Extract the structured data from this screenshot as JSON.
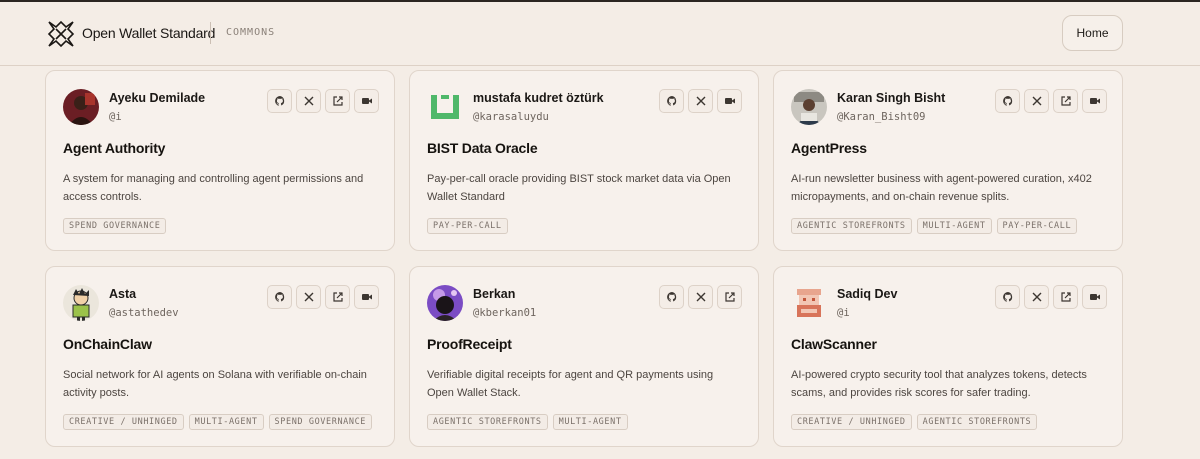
{
  "header": {
    "brand": "Open Wallet Standard",
    "section": "COMMONS",
    "home_label": "Home"
  },
  "cards": [
    {
      "name": "Ayeku Demilade",
      "handle": "@i",
      "title": "Agent Authority",
      "description": "A system for managing and controlling agent permissions and access controls.",
      "tags": [
        "SPEND GOVERNANCE"
      ],
      "actions": [
        "github",
        "x",
        "external",
        "video"
      ]
    },
    {
      "name": "mustafa kudret öztürk",
      "handle": "@karasaluydu",
      "title": "BIST Data Oracle",
      "description": "Pay-per-call oracle providing BIST stock market data via Open Wallet Standard",
      "tags": [
        "PAY-PER-CALL"
      ],
      "actions": [
        "github",
        "x",
        "video"
      ]
    },
    {
      "name": "Karan Singh Bisht",
      "handle": "@Karan_Bisht09",
      "title": "AgentPress",
      "description": "AI-run newsletter business with agent-powered curation, x402 micropayments, and on-chain revenue splits.",
      "tags": [
        "AGENTIC STOREFRONTS",
        "MULTI-AGENT",
        "PAY-PER-CALL"
      ],
      "actions": [
        "github",
        "x",
        "external",
        "video"
      ]
    },
    {
      "name": "Asta",
      "handle": "@astathedev",
      "title": "OnChainClaw",
      "description": "Social network for AI agents on Solana with verifiable on-chain activity posts.",
      "tags": [
        "CREATIVE / UNHINGED",
        "MULTI-AGENT",
        "SPEND GOVERNANCE"
      ],
      "actions": [
        "github",
        "x",
        "external",
        "video"
      ]
    },
    {
      "name": "Berkan",
      "handle": "@kberkan01",
      "title": "ProofReceipt",
      "description": "Verifiable digital receipts for agent and QR payments using Open Wallet Stack.",
      "tags": [
        "AGENTIC STOREFRONTS",
        "MULTI-AGENT"
      ],
      "actions": [
        "github",
        "x",
        "external"
      ]
    },
    {
      "name": "Sadiq Dev",
      "handle": "@i",
      "title": "ClawScanner",
      "description": "AI-powered crypto security tool that analyzes tokens, detects scams, and provides risk scores for safer trading.",
      "tags": [
        "CREATIVE / UNHINGED",
        "AGENTIC STOREFRONTS"
      ],
      "actions": [
        "github",
        "x",
        "external",
        "video"
      ]
    }
  ]
}
